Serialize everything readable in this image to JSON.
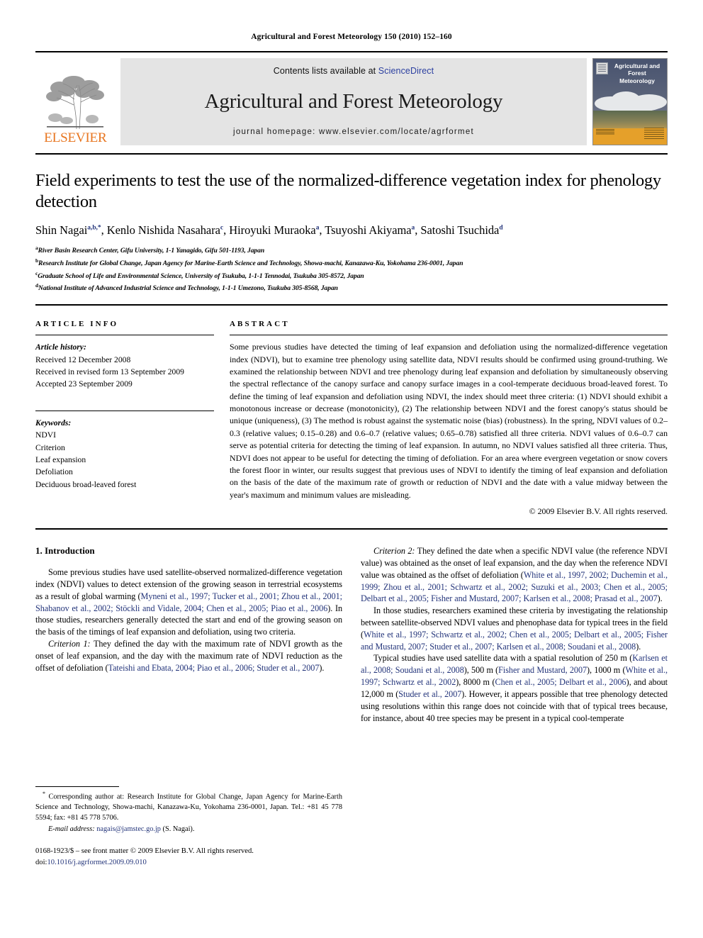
{
  "running_head": "Agricultural and Forest Meteorology 150 (2010) 152–160",
  "masthead": {
    "publisher_word": "ELSEVIER",
    "contents_prefix": "Contents lists available at ",
    "contents_link": "ScienceDirect",
    "journal_name": "Agricultural and Forest Meteorology",
    "homepage": "journal homepage: www.elsevier.com/locate/agrformet",
    "cover_title": "Agricultural and Forest Meteorology"
  },
  "article": {
    "title": "Field experiments to test the use of the normalized-difference vegetation index for phenology detection",
    "authors_html": "Shin Nagai<sup>a,b,*</sup>, Kenlo Nishida Nasahara<sup>c</sup>, Hiroyuki Muraoka<sup>a</sup>, Tsuyoshi Akiyama<sup>a</sup>, Satoshi Tsuchida<sup>d</sup>",
    "affiliations": [
      {
        "mark": "a",
        "text": "River Basin Research Center, Gifu University, 1-1 Yanagido, Gifu 501-1193, Japan"
      },
      {
        "mark": "b",
        "text": "Research Institute for Global Change, Japan Agency for Marine-Earth Science and Technology, Showa-machi, Kanazawa-Ku, Yokohama 236-0001, Japan"
      },
      {
        "mark": "c",
        "text": "Graduate School of Life and Environmental Science, University of Tsukuba, 1-1-1 Tennodai, Tsukuba 305-8572, Japan"
      },
      {
        "mark": "d",
        "text": "National Institute of Advanced Industrial Science and Technology, 1-1-1 Umezono, Tsukuba 305-8568, Japan"
      }
    ]
  },
  "article_info": {
    "heading": "ARTICLE INFO",
    "history_label": "Article history:",
    "history": [
      "Received 12 December 2008",
      "Received in revised form 13 September 2009",
      "Accepted 23 September 2009"
    ],
    "keywords_label": "Keywords:",
    "keywords": [
      "NDVI",
      "Criterion",
      "Leaf expansion",
      "Defoliation",
      "Deciduous broad-leaved forest"
    ]
  },
  "abstract": {
    "heading": "ABSTRACT",
    "text": "Some previous studies have detected the timing of leaf expansion and defoliation using the normalized-difference vegetation index (NDVI), but to examine tree phenology using satellite data, NDVI results should be confirmed using ground-truthing. We examined the relationship between NDVI and tree phenology during leaf expansion and defoliation by simultaneously observing the spectral reflectance of the canopy surface and canopy surface images in a cool-temperate deciduous broad-leaved forest. To define the timing of leaf expansion and defoliation using NDVI, the index should meet three criteria: (1) NDVI should exhibit a monotonous increase or decrease (monotonicity), (2) The relationship between NDVI and the forest canopy's status should be unique (uniqueness), (3) The method is robust against the systematic noise (bias) (robustness). In the spring, NDVI values of 0.2–0.3 (relative values; 0.15–0.28) and 0.6–0.7 (relative values; 0.65–0.78) satisfied all three criteria. NDVI values of 0.6–0.7 can serve as potential criteria for detecting the timing of leaf expansion. In autumn, no NDVI values satisfied all three criteria. Thus, NDVI does not appear to be useful for detecting the timing of defoliation. For an area where evergreen vegetation or snow covers the forest floor in winter, our results suggest that previous uses of NDVI to identify the timing of leaf expansion and defoliation on the basis of the date of the maximum rate of growth or reduction of NDVI and the date with a value midway between the year's maximum and minimum values are misleading.",
    "copyright": "© 2009 Elsevier B.V. All rights reserved."
  },
  "body": {
    "section_title": "1. Introduction",
    "left": {
      "p1_a": "Some previous studies have used satellite-observed normalized-difference vegetation index (NDVI) values to detect extension of the growing season in terrestrial ecosystems as a result of global warming (",
      "p1_cite": "Myneni et al., 1997; Tucker et al., 2001; Zhou et al., 2001; Shabanov et al., 2002; Stöckli and Vidale, 2004; Chen et al., 2005; Piao et al., 2006",
      "p1_b": "). In those studies, researchers generally detected the start and end of the growing season on the basis of the timings of leaf expansion and defoliation, using two criteria.",
      "p2_label": "Criterion 1:",
      "p2_a": " They defined the day with the maximum rate of NDVI growth as the onset of leaf expansion, and the day with the maximum rate of NDVI reduction as the offset of defoliation (",
      "p2_cite": "Tateishi and Ebata, 2004; Piao et al., 2006; Studer et al., 2007",
      "p2_b": ")."
    },
    "right": {
      "p1_label": "Criterion 2:",
      "p1_a": " They defined the date when a specific NDVI value (the reference NDVI value) was obtained as the onset of leaf expansion, and the day when the reference NDVI value was obtained as the offset of defoliation (",
      "p1_cite": "White et al., 1997, 2002; Duchemin et al., 1999; Zhou et al., 2001; Schwartz et al., 2002; Suzuki et al., 2003; Chen et al., 2005; Delbart et al., 2005; Fisher and Mustard, 2007; Karlsen et al., 2008; Prasad et al., 2007",
      "p1_b": ").",
      "p2_a": "In those studies, researchers examined these criteria by investigating the relationship between satellite-observed NDVI values and phenophase data for typical trees in the field (",
      "p2_cite": "White et al., 1997; Schwartz et al., 2002; Chen et al., 2005; Delbart et al., 2005; Fisher and Mustard, 2007; Studer et al., 2007; Karlsen et al., 2008; Soudani et al., 2008",
      "p2_b": ").",
      "p3_a": "Typical studies have used satellite data with a spatial resolution of 250 m (",
      "p3_c1": "Karlsen et al., 2008; Soudani et al., 2008",
      "p3_b": "), 500 m (",
      "p3_c2": "Fisher and Mustard, 2007",
      "p3_c": "), 1000 m (",
      "p3_c3": "White et al., 1997; Schwartz et al., 2002",
      "p3_d": "), 8000 m (",
      "p3_c4": "Chen et al., 2005; Delbart et al., 2006",
      "p3_e": "), and about 12,000 m (",
      "p3_c5": "Studer et al., 2007",
      "p3_f": "). However, it appears possible that tree phenology detected using resolutions within this range does not coincide with that of typical trees because, for instance, about 40 tree species may be present in a typical cool-temperate"
    }
  },
  "footnotes": {
    "corresponding": "Corresponding author at: Research Institute for Global Change, Japan Agency for Marine-Earth Science and Technology, Showa-machi, Kanazawa-Ku, Yokohama 236-0001, Japan. Tel.: +81 45 778 5594; fax: +81 45 778 5706.",
    "email_label": "E-mail address:",
    "email_address": "nagais@jamstec.go.jp",
    "email_owner": "(S. Nagai).",
    "imprint_line": "0168-1923/$ – see front matter © 2009 Elsevier B.V. All rights reserved.",
    "doi_prefix": "doi:",
    "doi_value": "10.1016/j.agrformet.2009.09.010"
  },
  "colors": {
    "link_blue": "#23347a",
    "sciencedirect_blue": "#2b3fa0",
    "elsevier_orange": "#E87722",
    "band_gray": "#e4e4e4"
  }
}
